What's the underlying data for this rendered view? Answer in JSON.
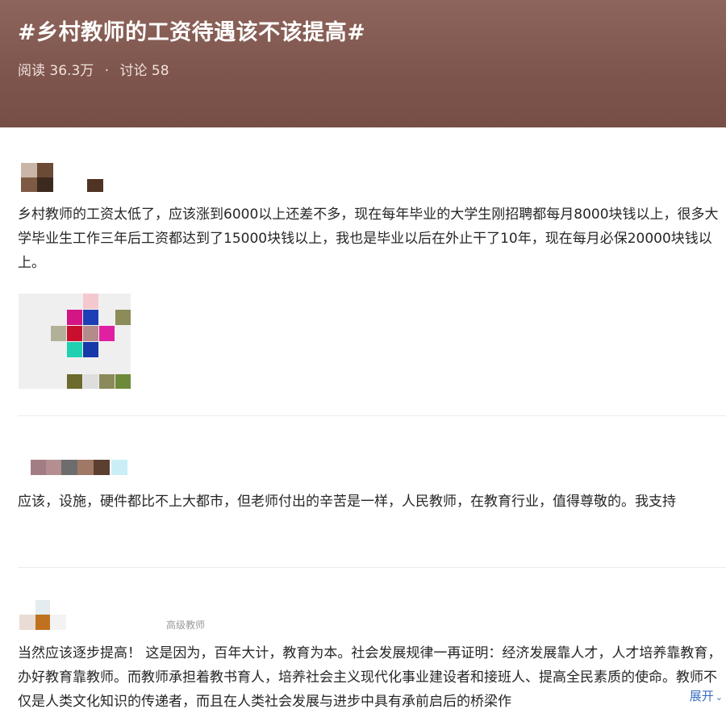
{
  "topic": {
    "title": "#乡村教师的工资待遇该不该提高#",
    "reads_label": "阅读",
    "reads_value": "36.3万",
    "separator": "·",
    "comments_label": "讨论",
    "comments_value": "58"
  },
  "posts": [
    {
      "text": "乡村教师的工资太低了，应该涨到6000以上还差不多，现在每年毕业的大学生刚招聘都每月8000块钱以上，很多大学毕业生工作三年后工资都达到了15000块钱以上，我也是毕业以后在外止干了10年，现在每月必保20000块钱以上。"
    },
    {
      "text": "应该，设施，硬件都比不上大都市，但老师付出的辛苦是一样，人民教师，在教育行业，值得尊敬的。我支持"
    },
    {
      "badge": "高级教师",
      "text": "当然应该逐步提高！ 这是因为，百年大计，教育为本。社会发展规律一再证明：经济发展靠人才，人才培养靠教育，办好教育靠教师。而教师承担着教书育人，培养社会主义现代化事业建设者和接班人、提高全民素质的使命。教师不仅是人类文化知识的传递者，而且在人类社会发展与进步中具有承前启后的桥梁作",
      "expand_label": "展开"
    }
  ],
  "colors": {
    "header_bg": "#7f564d",
    "link": "#3b6fc2"
  },
  "icons": {
    "expand": "chevron-down-icon"
  }
}
